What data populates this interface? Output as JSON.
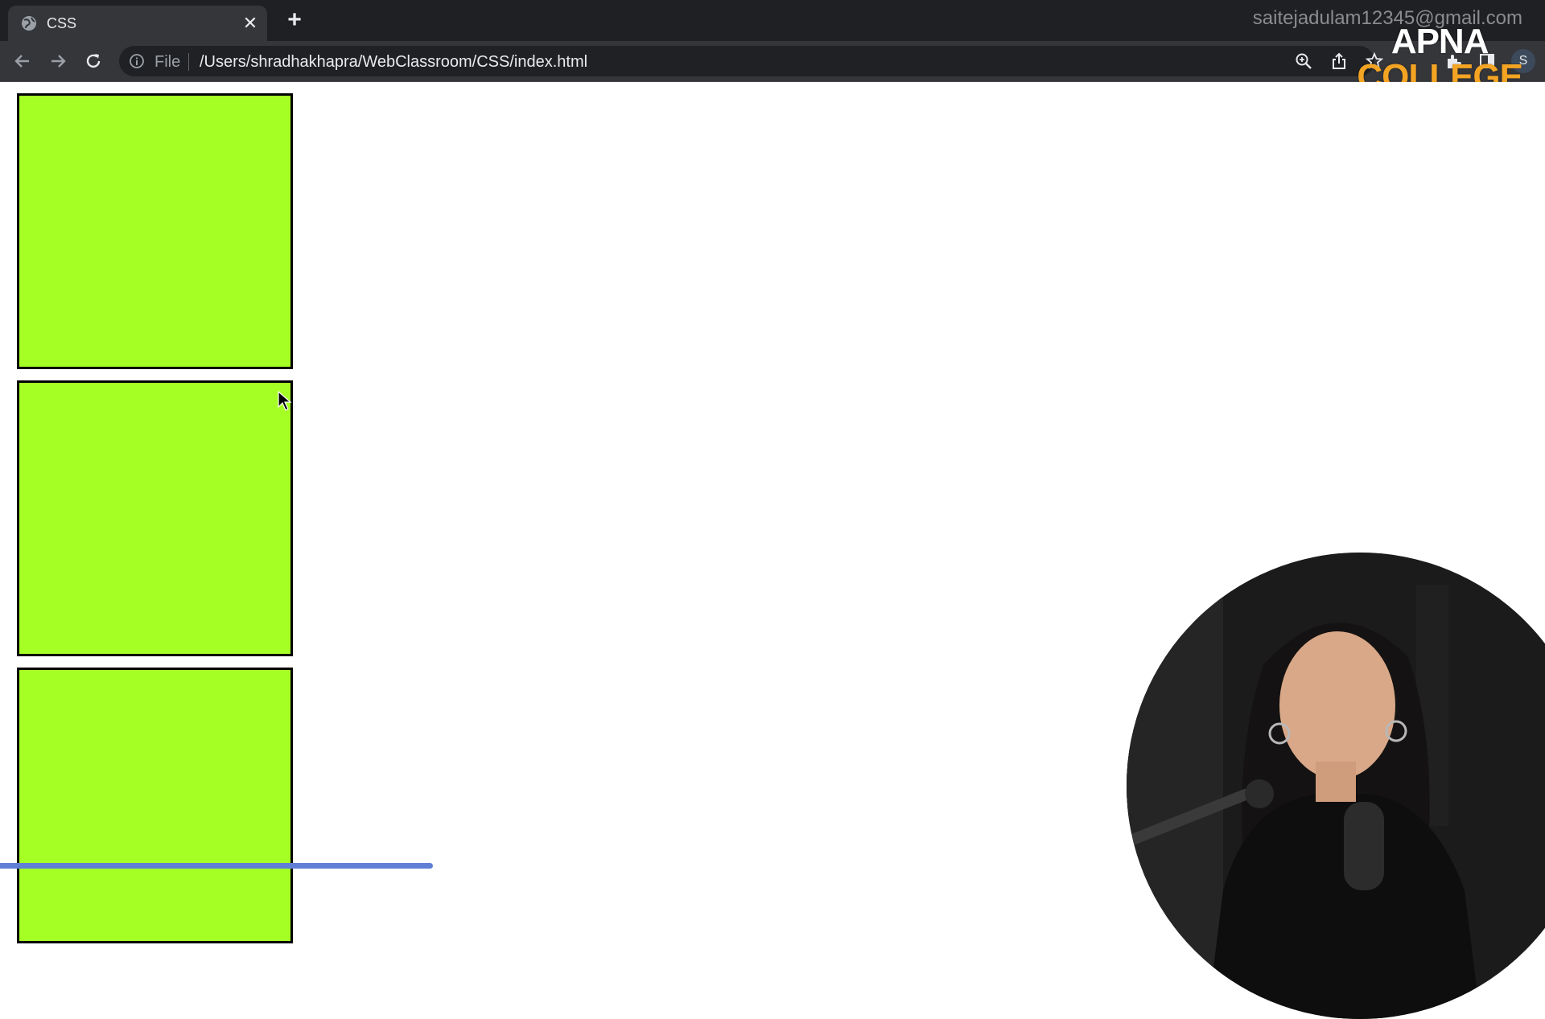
{
  "browser": {
    "tab": {
      "title": "CSS",
      "close_glyph": "✕"
    },
    "new_tab_glyph": "+",
    "account_email": "saitejadulam12345@gmail.com",
    "address_bar": {
      "scheme_label": "File",
      "url": "/Users/shradhakhapra/WebClassroom/CSS/index.html"
    },
    "profile_initial": "S",
    "icons": [
      "globe-icon",
      "back-icon",
      "forward-icon",
      "reload-icon",
      "info-icon",
      "zoom-icon",
      "share-icon",
      "bookmark-star-icon",
      "extensions-icon",
      "sidebar-icon"
    ]
  },
  "watermark": {
    "line1": "APNA",
    "line2": "COLLEGE"
  },
  "page": {
    "box_color": "#a6ff24",
    "boxes": [
      {},
      {},
      {}
    ]
  },
  "colors": {
    "tabstrip": "#1f2023",
    "toolbar": "#35363a",
    "accent_progress": "#5f7fd6",
    "watermark_orange": "#f4a423"
  }
}
